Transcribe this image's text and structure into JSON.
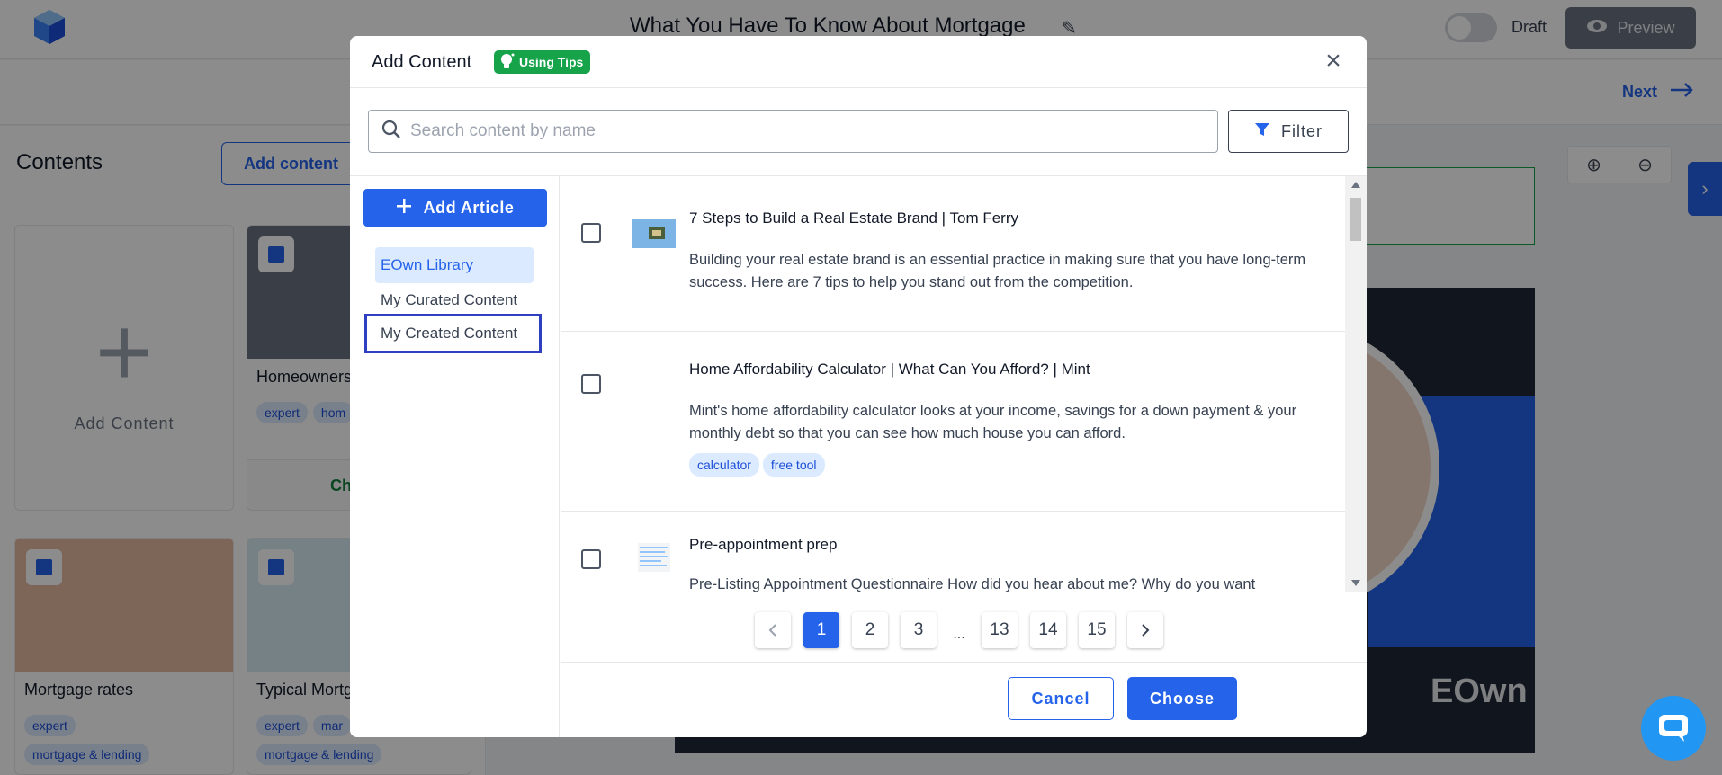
{
  "app": {
    "document_title": "What You Have To Know About Mortgage",
    "draft_label": "Draft",
    "preview_label": "Preview",
    "next_label": "Next",
    "brand_text": "EOwn",
    "colors": {
      "primary": "#2563eb",
      "tips": "#16a34a",
      "focus": "#2e3fbf"
    }
  },
  "left_panel": {
    "title": "Contents",
    "add_button": "Add content",
    "add_card_label": "Add Content",
    "cards": [
      {
        "title": "Homeowners",
        "tags": [
          "expert",
          "hom"
        ],
        "choose_label": "Ch"
      },
      {
        "title": "Mortgage rates",
        "tags": [
          "expert",
          "mortgage & lending"
        ]
      },
      {
        "title": "Typical Mortg",
        "tags": [
          "expert",
          "mar",
          "mortgage & lending"
        ]
      }
    ]
  },
  "modal": {
    "title": "Add Content",
    "tips_label": "Using Tips",
    "search": {
      "placeholder": "Search content by name",
      "value": ""
    },
    "filter_label": "Filter",
    "add_article_label": "Add Article",
    "nav": [
      {
        "label": "EOwn Library",
        "active": true
      },
      {
        "label": "My Curated Content",
        "active": false
      },
      {
        "label": "My Created Content",
        "active": false
      }
    ],
    "items": [
      {
        "title": "7 Steps to Build a Real Estate Brand | Tom Ferry",
        "description": "Building your real estate brand is an essential practice in making sure that you have long-term success. Here are 7 tips to help you stand out from the competition.",
        "tags": [],
        "checked": false
      },
      {
        "title": "Home Affordability Calculator | What Can You Afford? | Mint",
        "description": "Mint's home affordability calculator looks at your income, savings for a down payment & your monthly debt so that you can see how much house you can afford.",
        "tags": [
          "calculator",
          "free tool"
        ],
        "checked": false
      },
      {
        "title": "Pre-appointment prep",
        "description": "Pre-Listing Appointment Questionnaire How did you hear about me? Why do you want",
        "tags": [],
        "checked": false
      }
    ],
    "pagination": {
      "current": 1,
      "pages": [
        "1",
        "2",
        "3",
        "...",
        "13",
        "14",
        "15"
      ]
    },
    "cancel_label": "Cancel",
    "choose_label": "Choose"
  }
}
